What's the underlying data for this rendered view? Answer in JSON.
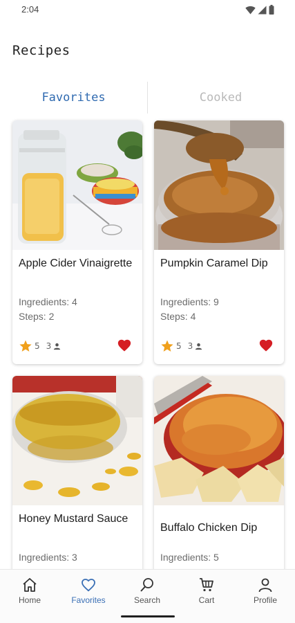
{
  "status_bar": {
    "time": "2:04"
  },
  "header": {
    "title": "Recipes"
  },
  "tabs": [
    {
      "label": "Favorites",
      "active": true
    },
    {
      "label": "Cooked",
      "active": false
    }
  ],
  "recipes": [
    {
      "name": "Apple Cider Vinaigrette",
      "ingredients": "Ingredients: 4",
      "steps": "Steps: 2",
      "rating": "5",
      "reviews": "3",
      "favorite": true
    },
    {
      "name": "Pumpkin Caramel Dip",
      "ingredients": "Ingredients: 9",
      "steps": "Steps: 4",
      "rating": "5",
      "reviews": "3",
      "favorite": true
    },
    {
      "name": "Honey Mustard Sauce",
      "ingredients": "Ingredients: 3",
      "steps": "",
      "rating": "",
      "reviews": "",
      "favorite": true
    },
    {
      "name": "Buffalo Chicken Dip",
      "ingredients": "Ingredients: 5",
      "steps": "",
      "rating": "",
      "reviews": "",
      "favorite": true
    }
  ],
  "bottom_nav": [
    {
      "label": "Home",
      "icon": "home-icon",
      "active": false
    },
    {
      "label": "Favorites",
      "icon": "heart-icon",
      "active": true
    },
    {
      "label": "Search",
      "icon": "search-icon",
      "active": false
    },
    {
      "label": "Cart",
      "icon": "cart-icon",
      "active": false
    },
    {
      "label": "Profile",
      "icon": "person-icon",
      "active": false
    }
  ],
  "colors": {
    "accent": "#3a6fb5",
    "star": "#f0a01c",
    "heart": "#d51e24"
  }
}
